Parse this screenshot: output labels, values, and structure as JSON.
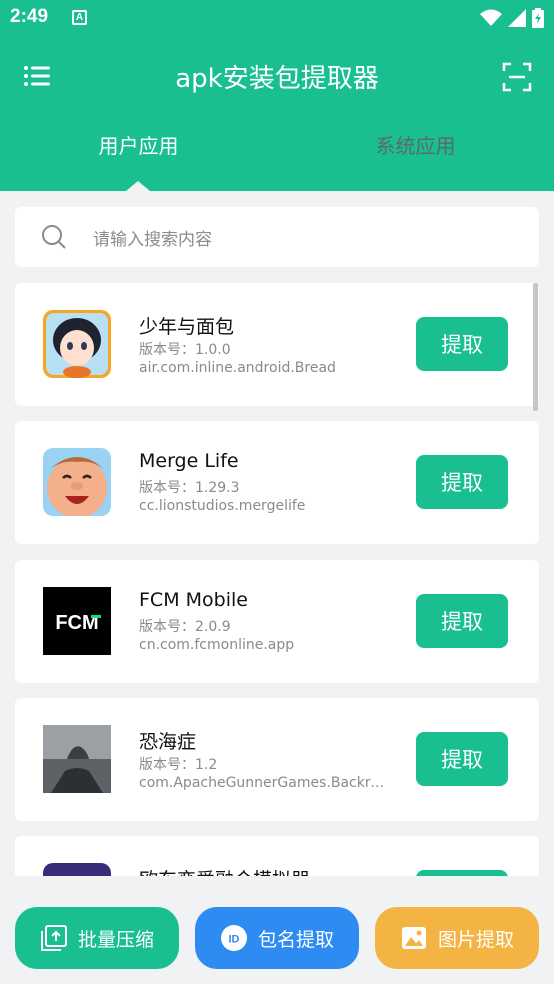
{
  "status_bar": {
    "time": "2:49",
    "notif_badge": "A",
    "icons": [
      "wifi-icon",
      "signal-icon",
      "battery-icon"
    ]
  },
  "header": {
    "title": "apk安装包提取器",
    "menu_icon": "menu-icon",
    "scan_icon": "scan-icon"
  },
  "tabs": [
    {
      "label": "用户应用",
      "active": true
    },
    {
      "label": "系统应用",
      "active": false
    }
  ],
  "search": {
    "placeholder": "请输入搜索内容"
  },
  "apps": [
    {
      "name": "少年与面包",
      "version": "版本号：1.0.0",
      "package": "air.com.inline.android.Bread",
      "action": "提取"
    },
    {
      "name": "Merge Life",
      "version": "版本号：1.29.3",
      "package": "cc.lionstudios.mergelife",
      "action": "提取"
    },
    {
      "name": "FCM Mobile",
      "version": "版本号：2.0.9",
      "package": "cn.com.fcmonline.app",
      "action": "提取",
      "icon_text": "FCM"
    },
    {
      "name": "恐海症",
      "version": "版本号：1.2",
      "package": "com.ApacheGunnerGames.Backro...",
      "action": "提取"
    },
    {
      "name": "欧东恋爱融合模拟器",
      "version": "",
      "package": "",
      "action": "提取"
    }
  ],
  "bottom_buttons": [
    {
      "label": "批量压缩",
      "icon": "compress-icon",
      "color": "#1abf91"
    },
    {
      "label": "包名提取",
      "icon": "id-icon",
      "color": "#2e8bf2"
    },
    {
      "label": "图片提取",
      "icon": "image-icon",
      "color": "#f3b444"
    }
  ],
  "colors": {
    "primary": "#1abf91",
    "blue": "#2e8bf2",
    "orange": "#f3b444"
  }
}
